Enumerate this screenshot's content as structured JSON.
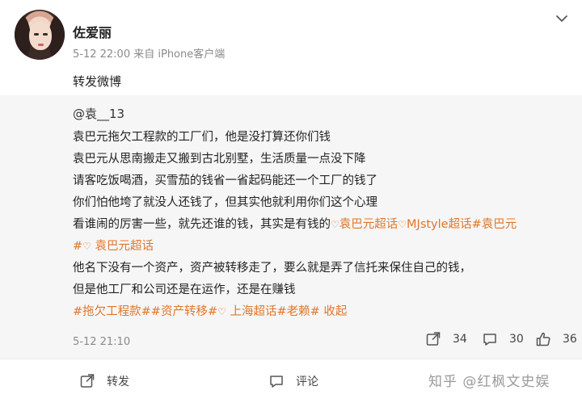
{
  "post": {
    "user_name": "佐爱丽",
    "meta": "5-12 22:00  来自 iPhone客户端",
    "repost_text": "转发微博"
  },
  "original": {
    "author": "@袁__13",
    "lines": [
      "袁巴元拖欠工程款的工厂们，他是没打算还你们钱",
      "袁巴元从思南搬走又搬到古北别墅，生活质量一点没下降",
      "请客吃饭喝酒，买雪茄的钱省一省起码能还一个工厂的钱了",
      "你们怕他垮了就没人还钱了，但其实他就利用你们这个心理"
    ],
    "line5_text": "看谁闹的厉害一些，就先还谁的钱，其实是有钱的",
    "line5_tag1": "袁巴元超话",
    "line5_tag2": "MJstyle超话",
    "line5_tag3": "#袁巴元",
    "line6_tag": "#",
    "line6_tag2": "袁巴元超话",
    "line7": "他名下没有一个资产，资产被转移走了，要么就是弄了信托来保住自己的钱，",
    "line8": "但是他工厂和公司还是在运作，还是在赚钱",
    "line9_tag1": "#拖欠工程款##资产转移#",
    "line9_tag2": "上海超话",
    "line9_tag3": "#老赖#",
    "line9_more": "收起",
    "time": "5-12 21:10",
    "repost_count": "34",
    "comment_count": "30",
    "like_count": "36"
  },
  "actions": {
    "repost_label": "转发",
    "comment_label": "评论"
  },
  "watermark": "知乎 @红枫文史娱",
  "colors": {
    "tag": "#e0762a",
    "quote_bg": "#f6f6f6",
    "meta": "#8a8a8a"
  },
  "icons": [
    "chevron-down-icon",
    "repost-icon",
    "comment-icon",
    "like-icon",
    "heart-icon"
  ]
}
